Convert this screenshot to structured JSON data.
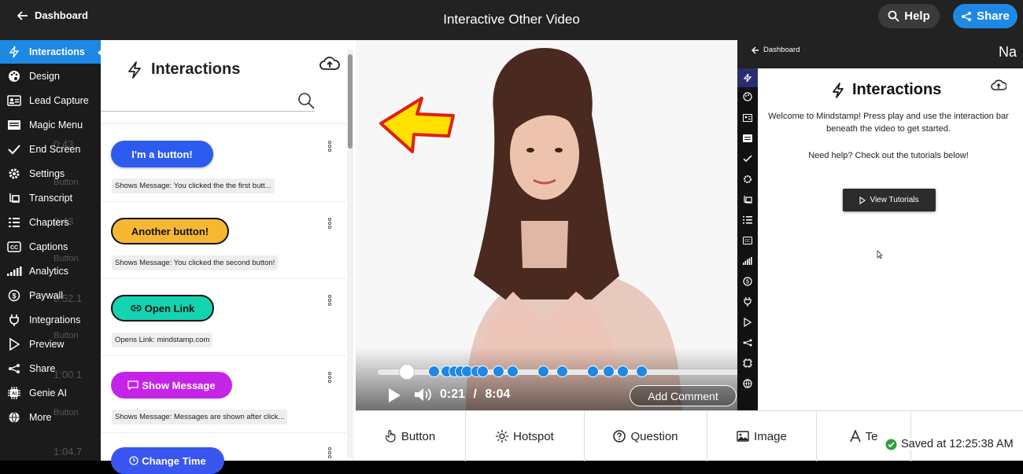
{
  "header": {
    "back_label": "Dashboard",
    "title": "Interactive Other Video",
    "help_label": "Help",
    "share_label": "Share"
  },
  "sidebar": {
    "items": [
      {
        "label": "Interactions",
        "icon": "bolt-icon",
        "active": true
      },
      {
        "label": "Design",
        "icon": "palette-icon"
      },
      {
        "label": "Lead Capture",
        "icon": "id-card-icon"
      },
      {
        "label": "Magic Menu",
        "icon": "menu-card-icon"
      },
      {
        "label": "End Screen",
        "icon": "check-icon"
      },
      {
        "label": "Settings",
        "icon": "gear-icon"
      },
      {
        "label": "Transcript",
        "icon": "transcript-icon"
      },
      {
        "label": "Chapters",
        "icon": "list-icon"
      },
      {
        "label": "Captions",
        "icon": "cc-icon"
      },
      {
        "label": "Analytics",
        "icon": "signal-bars-icon"
      },
      {
        "label": "Paywall",
        "icon": "dollar-icon"
      },
      {
        "label": "Integrations",
        "icon": "plug-icon"
      },
      {
        "label": "Preview",
        "icon": "play-outline-icon"
      },
      {
        "label": "Share",
        "icon": "share-nodes-icon"
      },
      {
        "label": "Genie AI",
        "icon": "ai-chip-icon"
      },
      {
        "label": "More",
        "icon": "globe-icon"
      }
    ],
    "ghost_labels": [
      "0:43",
      "Button",
      "0:43",
      "Button",
      "0:52.1",
      "Button",
      "1:00.1",
      "Button",
      "1:04.7"
    ]
  },
  "panel": {
    "title": "Interactions",
    "search_placeholder": "",
    "cards": [
      {
        "button_label": "I'm a button!",
        "description": "Shows Message: You clicked the the first butt...",
        "bg": "#2d5bf0",
        "fg": "#ffffff",
        "border": "#2d5bf0"
      },
      {
        "button_label": "Another button!",
        "description": "Shows Message: You clicked the second button!",
        "bg": "#f7b733",
        "fg": "#111111",
        "border": "#111111"
      },
      {
        "button_label": "Open Link",
        "description": "Opens Link: mindstamp.com",
        "bg": "#14d3b0",
        "fg": "#111111",
        "border": "#111111",
        "icon": "link-icon"
      },
      {
        "button_label": "Show Message",
        "description": "Shows Message: Messages are shown after click...",
        "bg": "#c524e6",
        "fg": "#ffffff",
        "border": "#c524e6",
        "icon": "message-icon"
      },
      {
        "button_label": "Change Time",
        "description": "",
        "bg": "#3a56f0",
        "fg": "#ffffff",
        "border": "#3a56f0",
        "icon": "clock-icon"
      }
    ]
  },
  "player": {
    "current_time": "0:21",
    "separator": "/",
    "duration": "8:04",
    "add_comment_label": "Add Comment",
    "progress_fraction": 0.043
  },
  "preview": {
    "back_label": "Dashboard",
    "title_fragment": "Na",
    "title": "Interactions",
    "welcome_text": "Welcome to Mindstamp! Press play and use the interaction bar beneath the video to get started.",
    "help_text": "Need help? Check out the tutorials below!",
    "view_tutorials_label": "View Tutorials"
  },
  "toolbar": {
    "tools": [
      {
        "label": "Button",
        "icon": "hand-pointer-icon"
      },
      {
        "label": "Hotspot",
        "icon": "hotspot-icon"
      },
      {
        "label": "Question",
        "icon": "question-circle-icon"
      },
      {
        "label": "Image",
        "icon": "image-icon"
      },
      {
        "label": "Te",
        "icon": "text-icon"
      }
    ]
  },
  "status": {
    "saved_text": "Saved at 12:25:38 AM"
  },
  "colors": {
    "accent": "#1e88e5",
    "sidebar_bg": "#1b1b1b",
    "topbar_bg": "#222222",
    "marker": "#1e88e5",
    "saved_check": "#2e9e44"
  }
}
